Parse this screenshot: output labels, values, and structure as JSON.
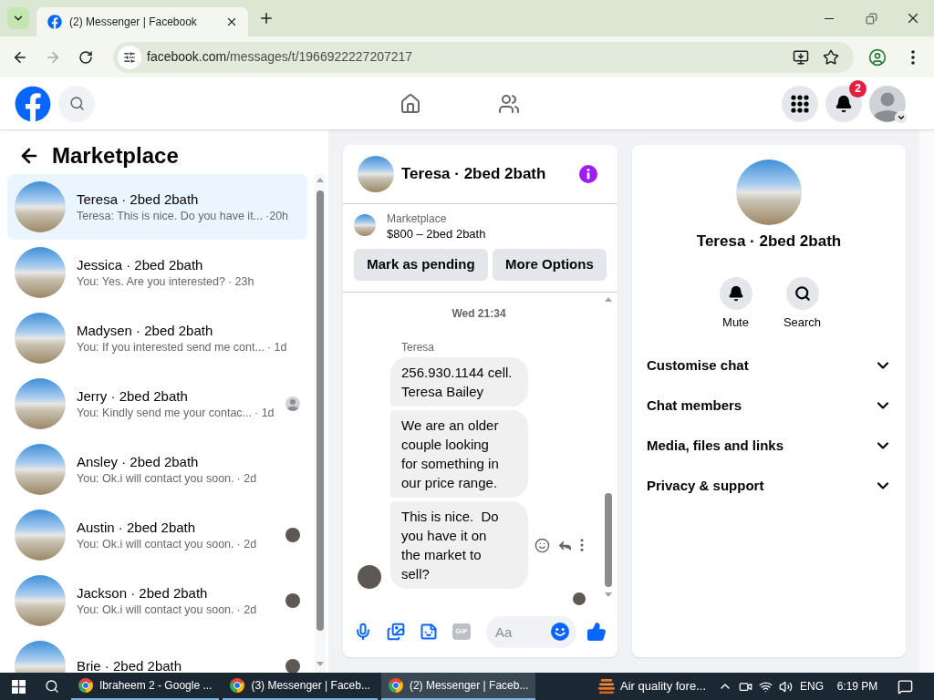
{
  "browser": {
    "tabs": [
      {
        "title": "(2) Messenger | Facebook",
        "selected": true
      }
    ],
    "forward_disabled": true,
    "address": {
      "host": "facebook.com",
      "path": "/messages/t/1966922227207217"
    }
  },
  "header": {
    "notification_count": "2"
  },
  "sidebar": {
    "title": "Marketplace",
    "conversations": [
      {
        "name": "Teresa · 2bed 2bath",
        "preview": "Teresa: This is nice. Do you have it...",
        "time": "·20h",
        "selected": true
      },
      {
        "name": "Jessica · 2bed 2bath",
        "preview": "You: Yes. Are you interested?",
        "time": "· 23h",
        "selected": false
      },
      {
        "name": "Madysen · 2bed 2bath",
        "preview": "You: If you interested send me cont...",
        "time": "· 1d",
        "selected": false
      },
      {
        "name": "Jerry · 2bed 2bath",
        "preview": "You: Kindly send me your contac...",
        "time": "· 1d",
        "selected": false,
        "seen_avatar": {
          "kind": "default"
        }
      },
      {
        "name": "Ansley · 2bed 2bath",
        "preview": "You: Ok.i will contact you soon.",
        "time": "· 2d",
        "selected": false
      },
      {
        "name": "Austin · 2bed 2bath",
        "preview": "You: Ok.i will contact you soon.",
        "time": "· 2d",
        "selected": false,
        "seen_avatar": {
          "kind": "photo"
        }
      },
      {
        "name": "Jackson · 2bed 2bath",
        "preview": "You: Ok.i will contact you soon.",
        "time": "· 2d",
        "selected": false,
        "seen_avatar": {
          "kind": "photo"
        }
      },
      {
        "name": "Brie · 2bed 2bath",
        "selected": false,
        "seen_avatar": {
          "kind": "photo"
        }
      }
    ]
  },
  "chat": {
    "title": "Teresa · 2bed 2bath",
    "listing": {
      "label": "Marketplace",
      "title": "$800 – 2bed 2bath"
    },
    "actions": [
      {
        "label": "Mark as pending"
      },
      {
        "label": "More Options"
      }
    ],
    "timestamp": "Wed 21:34",
    "sender": "Teresa",
    "messages": [
      {
        "lines": [
          "256.930.1144 cell.",
          "Teresa Bailey"
        ]
      },
      {
        "lines": [
          "We are an older",
          "couple looking",
          "for something in",
          "our price range."
        ]
      },
      {
        "lines": [
          "This is nice.  Do",
          "you have it on",
          "the market to",
          "sell?"
        ]
      }
    ],
    "composer": {
      "gif_label": "GIF",
      "placeholder": "Aa"
    }
  },
  "details": {
    "title": "Teresa · 2bed 2bath",
    "actions": [
      {
        "kind": "mute",
        "label": "Mute"
      },
      {
        "kind": "search",
        "label": "Search"
      }
    ],
    "sections": [
      {
        "label": "Customise chat",
        "expanded": false
      },
      {
        "label": "Chat members",
        "expanded": false
      },
      {
        "label": "Media, files and links",
        "expanded": false
      },
      {
        "label": "Privacy & support",
        "expanded": false
      }
    ]
  },
  "taskbar": {
    "tasks": [
      {
        "title": "Ibraheem 2 - Google ...",
        "selected": false
      },
      {
        "title": "(3) Messenger | Faceb...",
        "selected": false
      },
      {
        "title": "(2) Messenger | Faceb...",
        "selected": true
      }
    ],
    "weather": "Air quality fore...",
    "language": "ENG",
    "time": "6:19 PM"
  }
}
